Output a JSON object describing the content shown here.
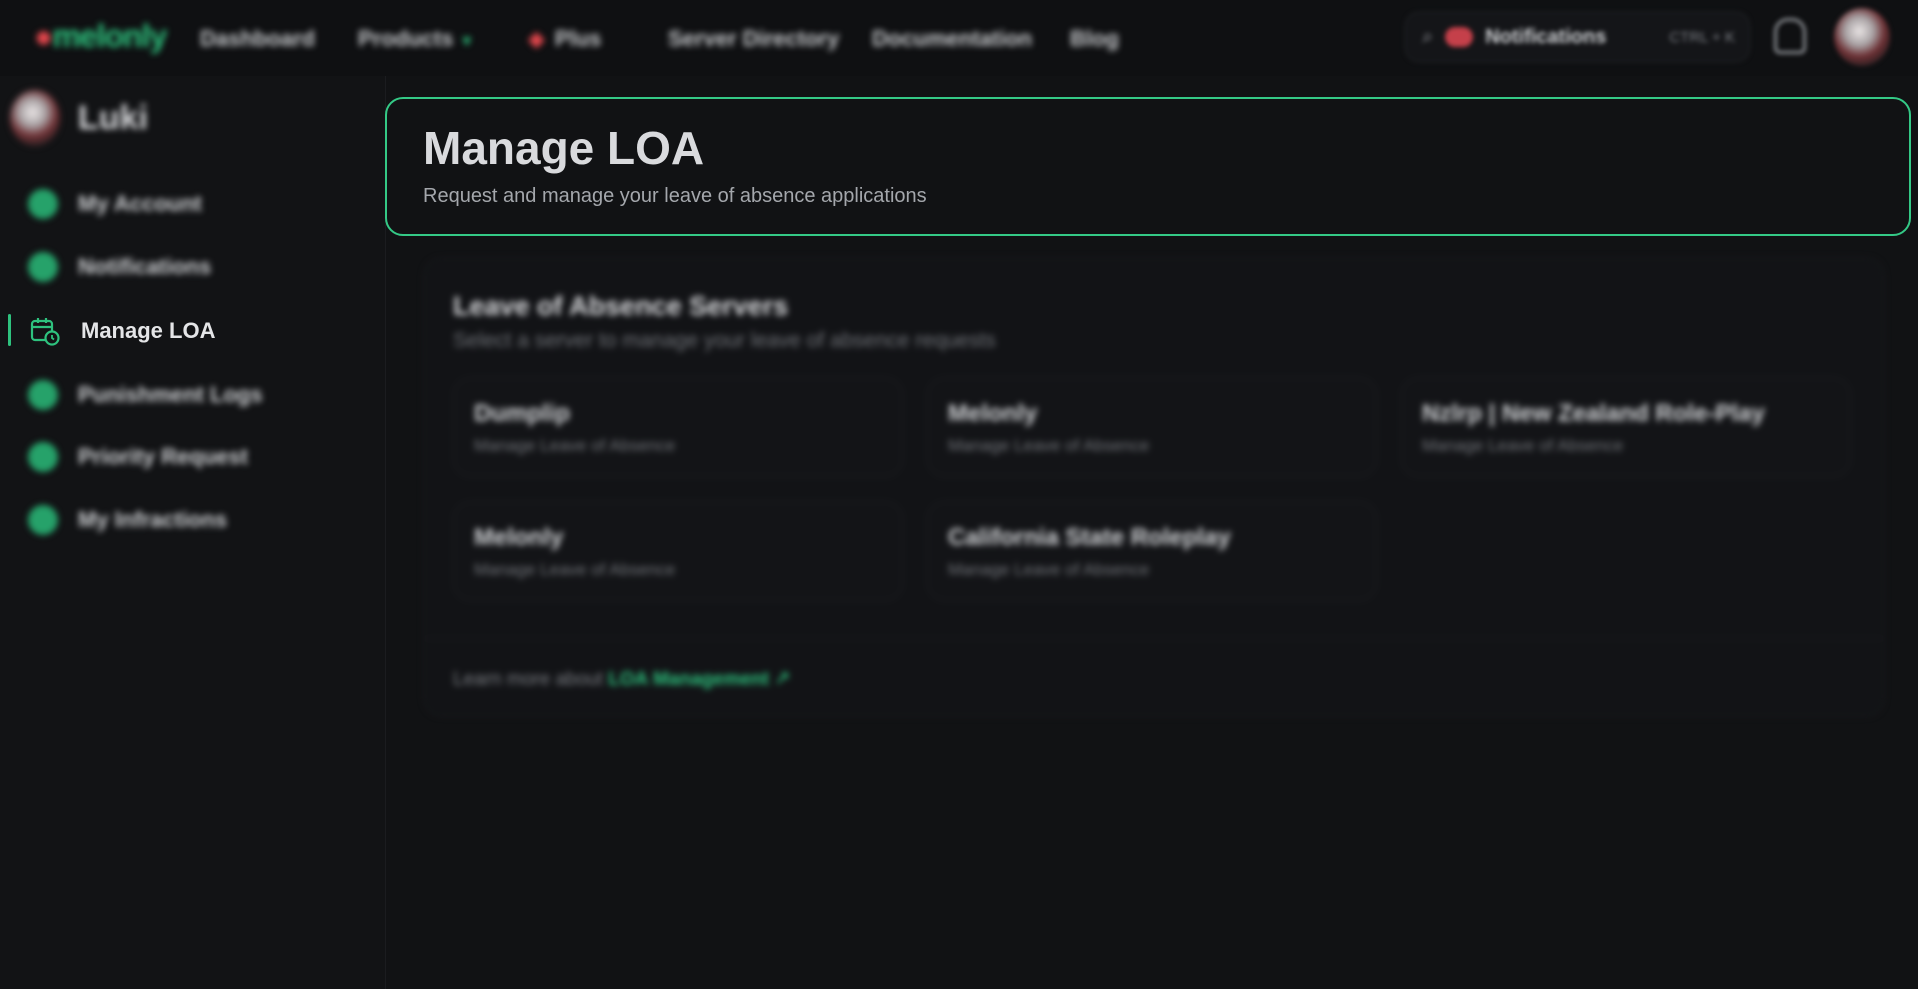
{
  "brand": {
    "logo": "melonly",
    "accent": "#2ec27e"
  },
  "nav": {
    "items": [
      {
        "label": "Dashboard"
      },
      {
        "label": "Products"
      },
      {
        "label": "Plus"
      },
      {
        "label": "Server Directory"
      },
      {
        "label": "Documentation"
      },
      {
        "label": "Blog"
      }
    ]
  },
  "search": {
    "text": "Notifications",
    "shortcut": "CTRL + K"
  },
  "sidebar": {
    "user": {
      "name": "Luki"
    },
    "items": [
      {
        "label": "My Account",
        "icon": "account-icon"
      },
      {
        "label": "Notifications",
        "icon": "bell-icon"
      },
      {
        "label": "Manage LOA",
        "icon": "calendar-clock-icon",
        "active": true
      },
      {
        "label": "Punishment Logs",
        "icon": "gavel-icon"
      },
      {
        "label": "Priority Request",
        "icon": "car-icon"
      },
      {
        "label": "My Infractions",
        "icon": "gavel-icon"
      }
    ]
  },
  "header": {
    "title": "Manage LOA",
    "subtitle": "Request and manage your leave of absence applications"
  },
  "servers": {
    "title": "Leave of Absence Servers",
    "subtitle": "Select a server to manage your leave of absence requests",
    "cards": [
      {
        "name": "Dumplip",
        "sub": "Manage Leave of Absence"
      },
      {
        "name": "Melonly",
        "sub": "Manage Leave of Absence"
      },
      {
        "name": "Nzlrp | New Zealand Role-Play",
        "sub": "Manage Leave of Absence"
      },
      {
        "name": "Melonly",
        "sub": "Manage Leave of Absence"
      },
      {
        "name": "California State Roleplay",
        "sub": "Manage Leave of Absence"
      }
    ],
    "footer_prefix": "Learn more about",
    "footer_link": "LOA Management"
  }
}
